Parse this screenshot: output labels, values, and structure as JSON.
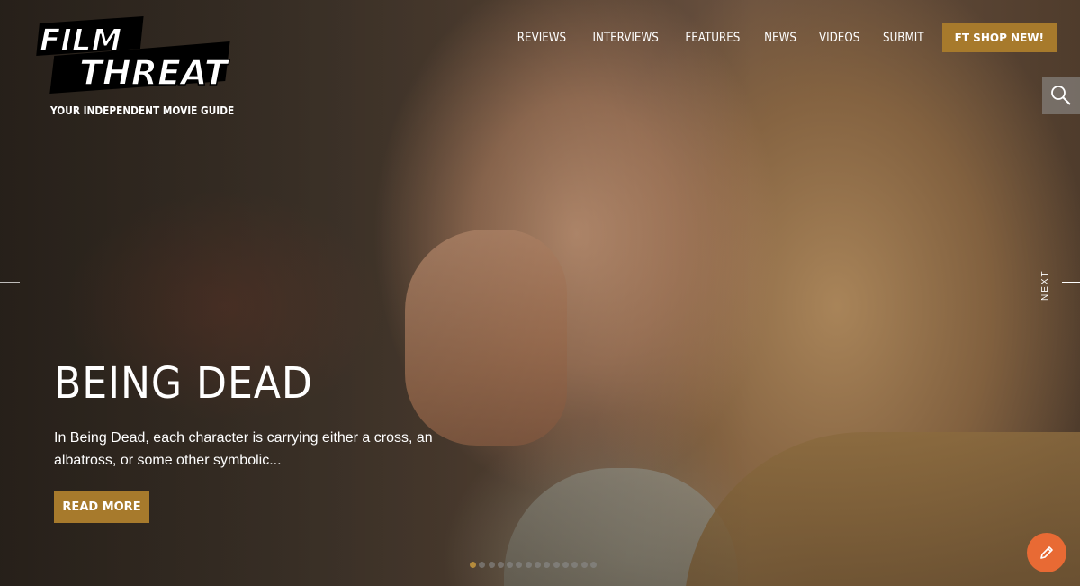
{
  "brand": {
    "logo_line1": "FILM",
    "logo_line2": "THREAT",
    "tagline": "YOUR INDEPENDENT MOVIE GUIDE"
  },
  "nav": {
    "items": [
      "REVIEWS",
      "INTERVIEWS",
      "FEATURES",
      "NEWS",
      "VIDEOS",
      "SUBMIT"
    ],
    "shop_label": "FT SHOP NEW!"
  },
  "slider": {
    "next_label": "NEXT",
    "title": "BEING DEAD",
    "excerpt": "In Being Dead, each character is carrying either a cross, an albatross, or some other symbolic...",
    "read_more_label": "READ MORE",
    "total_slides": 14,
    "active_slide": 1
  },
  "icons": {
    "search": "search-icon",
    "edit": "pencil-icon"
  },
  "colors": {
    "accent": "#a77a2c",
    "fab": "#e86a34"
  }
}
